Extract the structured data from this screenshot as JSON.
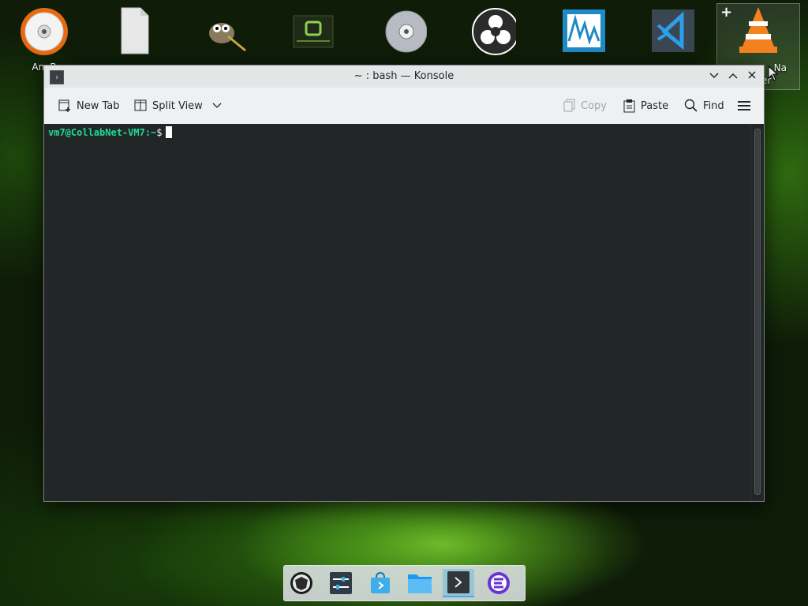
{
  "desktop": {
    "icons": [
      {
        "label": "AnyB",
        "icon": "disc-burner-icon"
      },
      {
        "label": "",
        "icon": "blank-file-icon"
      },
      {
        "label": "",
        "icon": "gimp-icon"
      },
      {
        "label": "",
        "icon": "mint-terminal-icon"
      },
      {
        "label": "",
        "icon": "optical-disc-icon"
      },
      {
        "label": "",
        "icon": "obs-icon"
      },
      {
        "label": "",
        "icon": "waveform-icon"
      },
      {
        "label": "",
        "icon": "vscode-icon"
      },
      {
        "label": "Na",
        "sublabel": "er",
        "icon": "vlc-icon"
      }
    ]
  },
  "window": {
    "title": "~ : bash — Konsole",
    "toolbar": {
      "new_tab": "New Tab",
      "split_view": "Split View",
      "copy": "Copy",
      "paste": "Paste",
      "find": "Find"
    },
    "terminal": {
      "user_host": "vm7@CollabNet-VM7",
      "path": ":~",
      "symbol": "$"
    }
  },
  "dock": {
    "items": [
      {
        "name": "app-launcher-icon"
      },
      {
        "name": "system-settings-icon"
      },
      {
        "name": "discover-store-icon"
      },
      {
        "name": "file-manager-icon"
      },
      {
        "name": "konsole-icon",
        "active": true
      },
      {
        "name": "browser-icon"
      }
    ]
  },
  "colors": {
    "prompt": "#1cdc9a",
    "terminal_bg": "#232627",
    "accent": "#3daee9"
  }
}
